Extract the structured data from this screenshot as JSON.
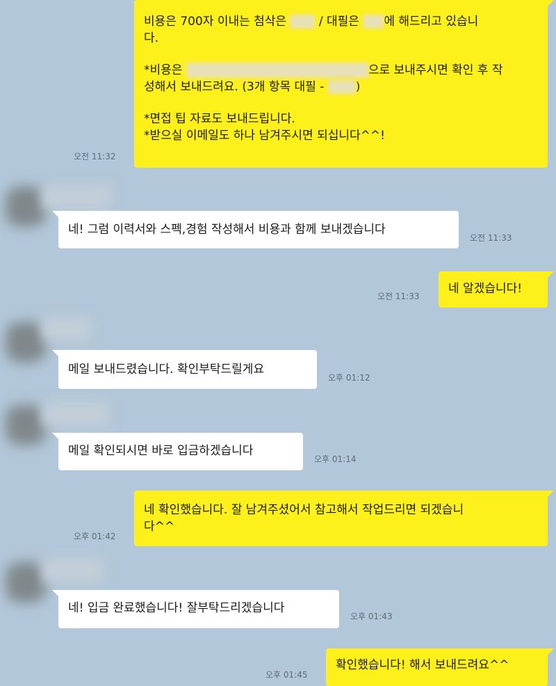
{
  "chat": {
    "messages": [
      {
        "from": "me",
        "lines": [
          "비용은 700자 이내는 첨삭은",
          "/ 대필은",
          "에 해드리고 있습니",
          "다.",
          "*비용은",
          "으로 보내주시면 확인 후 작",
          "성해서 보내드려요. (3개 항목 대필 -",
          ")",
          "*면접 팁 자료도 보내드립니다.",
          "*받으실 이메일도 하나 남겨주시면 되십니다^^!"
        ],
        "time": "오전 11:32"
      },
      {
        "from": "them",
        "text": "네! 그럼 이력서와 스펙,경험 작성해서 비용과 함께 보내겠습니다",
        "time": "오전 11:33"
      },
      {
        "from": "me",
        "text": "네 알겠습니다!",
        "time": "오전 11:33"
      },
      {
        "from": "them",
        "text": "메일 보내드렸습니다. 확인부탁드릴게요",
        "time": "오후 01:12"
      },
      {
        "from": "them",
        "text": "메일 확인되시면 바로 입금하겠습니다",
        "time": "오후 01:14"
      },
      {
        "from": "me",
        "lines": [
          "네 확인했습니다. 잘 남겨주셨어서 참고해서 작업드리면 되겠습니",
          "다^^"
        ],
        "time": "오후 01:42"
      },
      {
        "from": "them",
        "text": "네! 입금 완료했습니다! 잘부탁드리겠습니다",
        "time": "오후 01:43"
      },
      {
        "from": "me",
        "text": "확인했습니다! 해서 보내드려요^^",
        "time": "오후 01:45"
      }
    ]
  },
  "colors": {
    "background": "#b2c7d9",
    "my_bubble": "#fef01b",
    "their_bubble": "#ffffff",
    "time_text": "#5c6b78"
  }
}
